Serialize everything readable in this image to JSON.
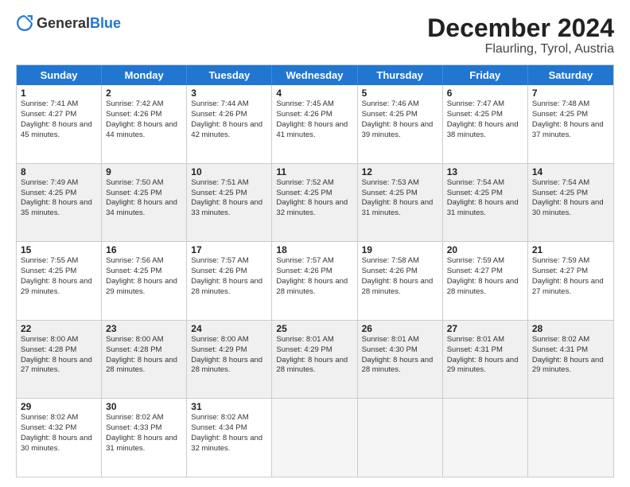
{
  "logo": {
    "general": "General",
    "blue": "Blue"
  },
  "title": "December 2024",
  "location": "Flaurling, Tyrol, Austria",
  "days_of_week": [
    "Sunday",
    "Monday",
    "Tuesday",
    "Wednesday",
    "Thursday",
    "Friday",
    "Saturday"
  ],
  "weeks": [
    [
      {
        "day": "1",
        "sunrise": "7:41 AM",
        "sunset": "4:27 PM",
        "daylight": "8 hours and 45 minutes."
      },
      {
        "day": "2",
        "sunrise": "7:42 AM",
        "sunset": "4:26 PM",
        "daylight": "8 hours and 44 minutes."
      },
      {
        "day": "3",
        "sunrise": "7:44 AM",
        "sunset": "4:26 PM",
        "daylight": "8 hours and 42 minutes."
      },
      {
        "day": "4",
        "sunrise": "7:45 AM",
        "sunset": "4:26 PM",
        "daylight": "8 hours and 41 minutes."
      },
      {
        "day": "5",
        "sunrise": "7:46 AM",
        "sunset": "4:25 PM",
        "daylight": "8 hours and 39 minutes."
      },
      {
        "day": "6",
        "sunrise": "7:47 AM",
        "sunset": "4:25 PM",
        "daylight": "8 hours and 38 minutes."
      },
      {
        "day": "7",
        "sunrise": "7:48 AM",
        "sunset": "4:25 PM",
        "daylight": "8 hours and 37 minutes."
      }
    ],
    [
      {
        "day": "8",
        "sunrise": "7:49 AM",
        "sunset": "4:25 PM",
        "daylight": "8 hours and 35 minutes."
      },
      {
        "day": "9",
        "sunrise": "7:50 AM",
        "sunset": "4:25 PM",
        "daylight": "8 hours and 34 minutes."
      },
      {
        "day": "10",
        "sunrise": "7:51 AM",
        "sunset": "4:25 PM",
        "daylight": "8 hours and 33 minutes."
      },
      {
        "day": "11",
        "sunrise": "7:52 AM",
        "sunset": "4:25 PM",
        "daylight": "8 hours and 32 minutes."
      },
      {
        "day": "12",
        "sunrise": "7:53 AM",
        "sunset": "4:25 PM",
        "daylight": "8 hours and 31 minutes."
      },
      {
        "day": "13",
        "sunrise": "7:54 AM",
        "sunset": "4:25 PM",
        "daylight": "8 hours and 31 minutes."
      },
      {
        "day": "14",
        "sunrise": "7:54 AM",
        "sunset": "4:25 PM",
        "daylight": "8 hours and 30 minutes."
      }
    ],
    [
      {
        "day": "15",
        "sunrise": "7:55 AM",
        "sunset": "4:25 PM",
        "daylight": "8 hours and 29 minutes."
      },
      {
        "day": "16",
        "sunrise": "7:56 AM",
        "sunset": "4:25 PM",
        "daylight": "8 hours and 29 minutes."
      },
      {
        "day": "17",
        "sunrise": "7:57 AM",
        "sunset": "4:26 PM",
        "daylight": "8 hours and 28 minutes."
      },
      {
        "day": "18",
        "sunrise": "7:57 AM",
        "sunset": "4:26 PM",
        "daylight": "8 hours and 28 minutes."
      },
      {
        "day": "19",
        "sunrise": "7:58 AM",
        "sunset": "4:26 PM",
        "daylight": "8 hours and 28 minutes."
      },
      {
        "day": "20",
        "sunrise": "7:59 AM",
        "sunset": "4:27 PM",
        "daylight": "8 hours and 28 minutes."
      },
      {
        "day": "21",
        "sunrise": "7:59 AM",
        "sunset": "4:27 PM",
        "daylight": "8 hours and 27 minutes."
      }
    ],
    [
      {
        "day": "22",
        "sunrise": "8:00 AM",
        "sunset": "4:28 PM",
        "daylight": "8 hours and 27 minutes."
      },
      {
        "day": "23",
        "sunrise": "8:00 AM",
        "sunset": "4:28 PM",
        "daylight": "8 hours and 28 minutes."
      },
      {
        "day": "24",
        "sunrise": "8:00 AM",
        "sunset": "4:29 PM",
        "daylight": "8 hours and 28 minutes."
      },
      {
        "day": "25",
        "sunrise": "8:01 AM",
        "sunset": "4:29 PM",
        "daylight": "8 hours and 28 minutes."
      },
      {
        "day": "26",
        "sunrise": "8:01 AM",
        "sunset": "4:30 PM",
        "daylight": "8 hours and 28 minutes."
      },
      {
        "day": "27",
        "sunrise": "8:01 AM",
        "sunset": "4:31 PM",
        "daylight": "8 hours and 29 minutes."
      },
      {
        "day": "28",
        "sunrise": "8:02 AM",
        "sunset": "4:31 PM",
        "daylight": "8 hours and 29 minutes."
      }
    ],
    [
      {
        "day": "29",
        "sunrise": "8:02 AM",
        "sunset": "4:32 PM",
        "daylight": "8 hours and 30 minutes."
      },
      {
        "day": "30",
        "sunrise": "8:02 AM",
        "sunset": "4:33 PM",
        "daylight": "8 hours and 31 minutes."
      },
      {
        "day": "31",
        "sunrise": "8:02 AM",
        "sunset": "4:34 PM",
        "daylight": "8 hours and 32 minutes."
      },
      null,
      null,
      null,
      null
    ]
  ]
}
